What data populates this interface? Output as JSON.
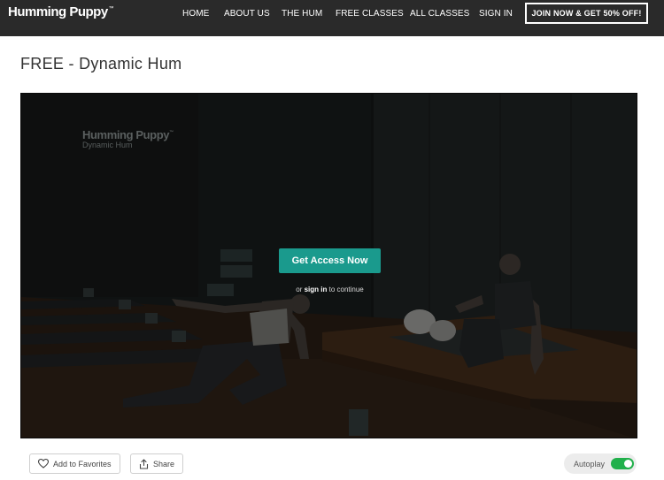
{
  "header": {
    "logo_text": "Humming Puppy",
    "logo_tm": "™",
    "nav": [
      "HOME",
      "ABOUT US",
      "THE HUM",
      "FREE CLASSES",
      "ALL CLASSES",
      "SIGN IN"
    ],
    "cta_label": "JOIN NOW & GET 50% OFF!"
  },
  "page": {
    "title": "FREE - Dynamic Hum"
  },
  "player": {
    "watermark_title": "Humming Puppy",
    "watermark_tm": "™",
    "watermark_subtitle": "Dynamic Hum",
    "access_button": "Get Access Now",
    "signin_prefix": "or ",
    "signin_link": "sign in",
    "signin_suffix": " to continue"
  },
  "controls": {
    "favorites_label": "Add to Favorites",
    "share_label": "Share",
    "autoplay_label": "Autoplay",
    "autoplay_on": true
  },
  "colors": {
    "header_bg": "#2a2a2a",
    "accent": "#1a9a8d",
    "toggle_on": "#21b04b"
  }
}
